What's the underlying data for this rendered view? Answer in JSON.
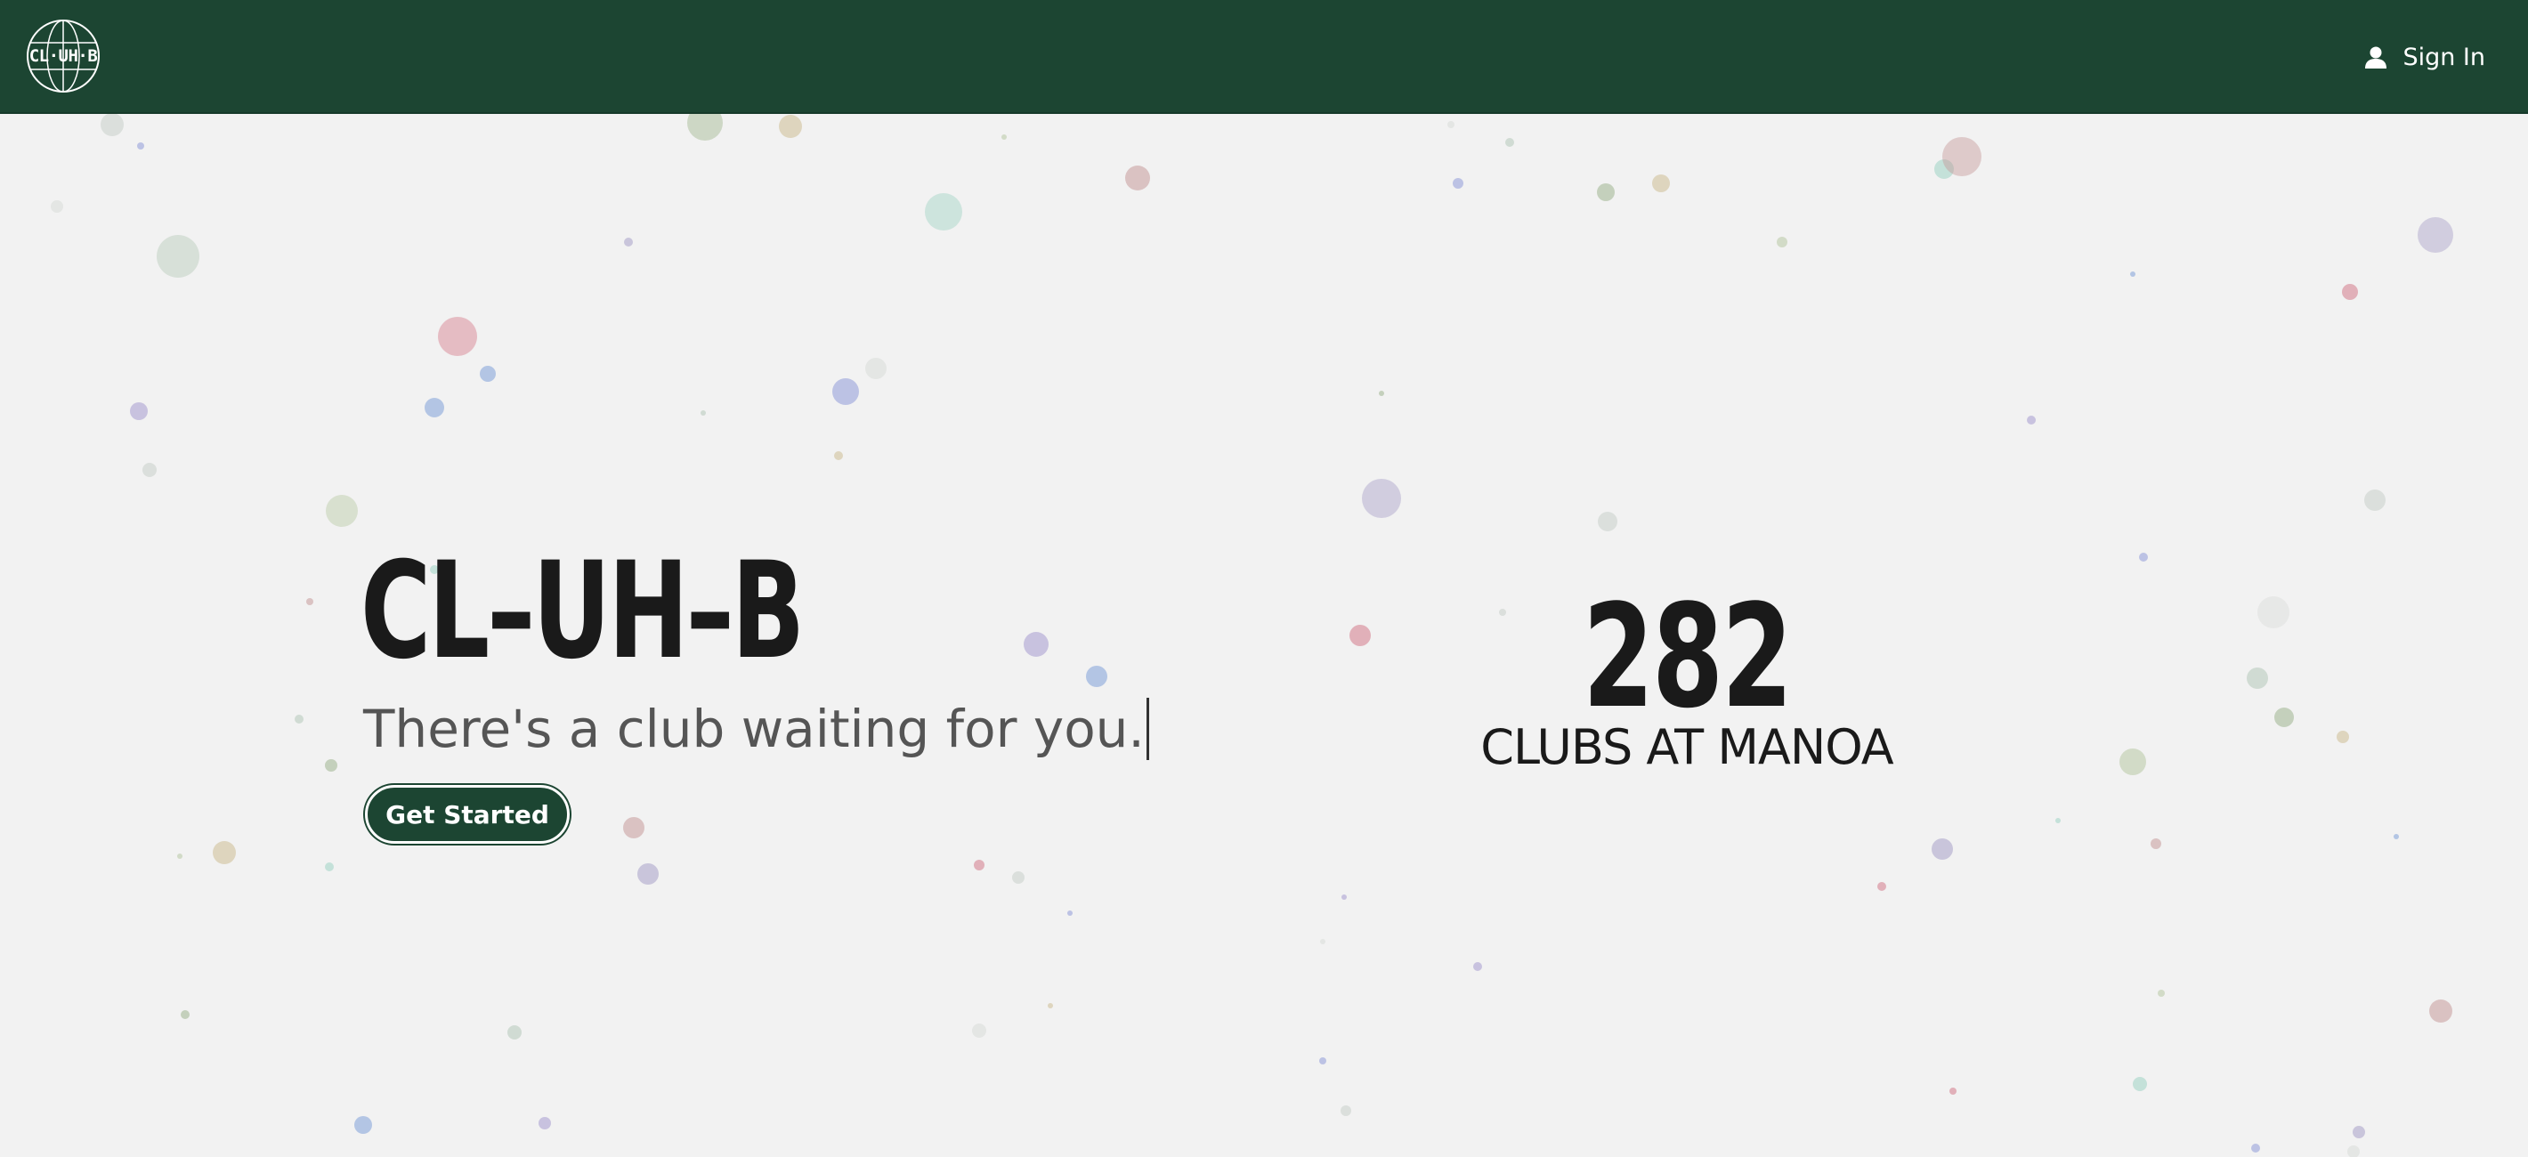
{
  "header": {
    "logo_text": "CL·UH·B",
    "signin_label": "Sign In"
  },
  "hero": {
    "title": "CL–UH–B",
    "tagline": "There's a club waiting for you.",
    "cta_label": "Get Started"
  },
  "stats": {
    "club_count": "282",
    "club_count_label": "CLUBS AT MANOA"
  },
  "colors": {
    "brand": "#1c4532",
    "background": "#f2f2f2",
    "text": "#1a1a1a",
    "tagline": "#555555"
  },
  "icons": {
    "logo": "globe-icon",
    "signin": "user-icon"
  }
}
